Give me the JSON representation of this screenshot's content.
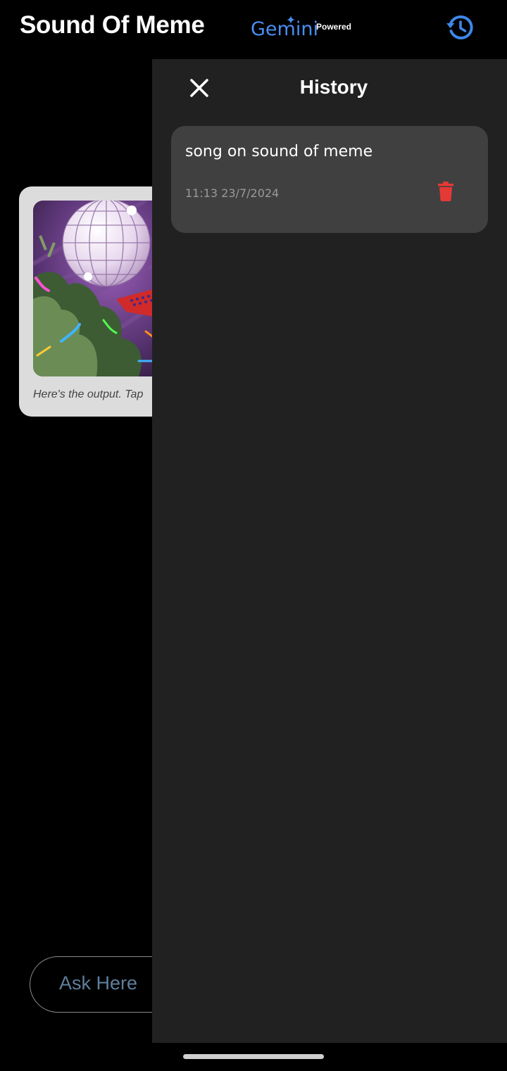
{
  "app": {
    "title": "Sound Of Meme",
    "gemini_logo": "Gemini",
    "powered_label": "Powered",
    "history_icon": "history-icon",
    "accent": "#4b8df0"
  },
  "main": {
    "output_caption": "Here's the output. Tap",
    "ask_placeholder": "Ask Here"
  },
  "drawer": {
    "title": "History",
    "close_icon": "close-icon",
    "items": [
      {
        "title": "song on sound of meme",
        "timestamp": "11:13 23/7/2024",
        "delete_icon": "trash-icon",
        "delete_color": "#e53935"
      }
    ]
  }
}
